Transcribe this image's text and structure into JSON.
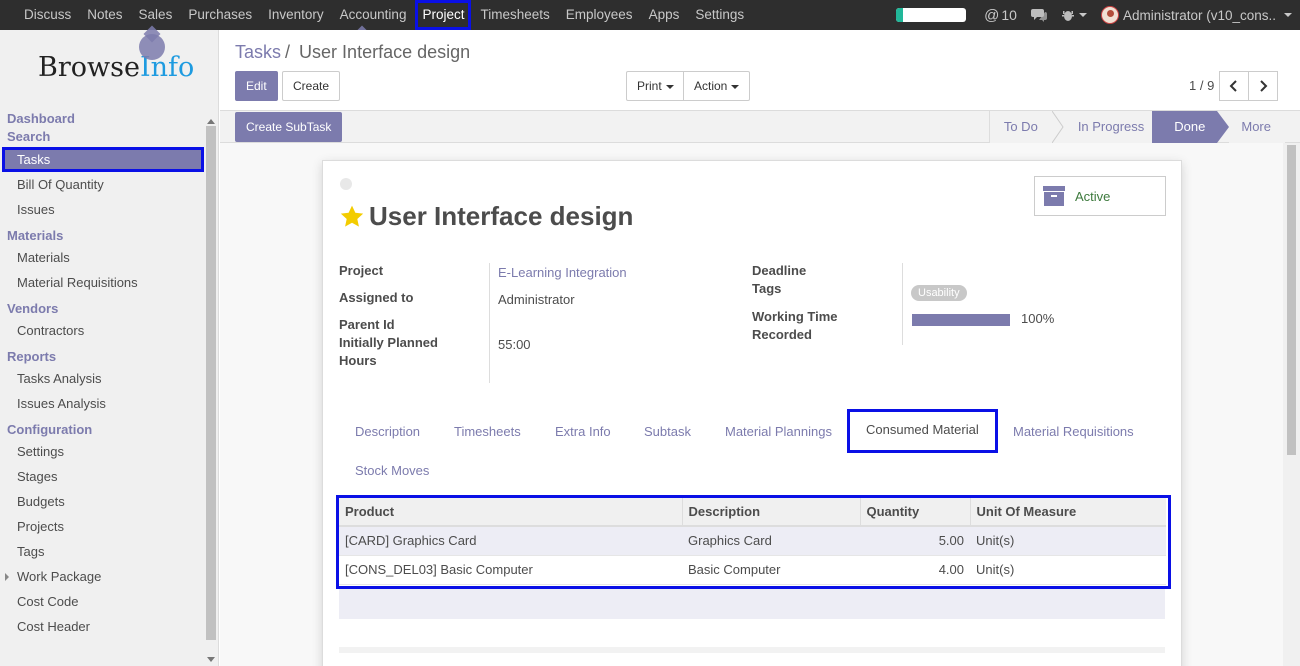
{
  "topbar": {
    "menu": [
      "Discuss",
      "Notes",
      "Sales",
      "Purchases",
      "Inventory",
      "Accounting",
      "Project",
      "Timesheets",
      "Employees",
      "Apps",
      "Settings"
    ],
    "active_menu": "Project",
    "progress_fraction": 0.1,
    "notifications_count": "10",
    "user_label": "Administrator (v10_cons..",
    "icons": [
      "at-icon",
      "chat-icon",
      "bug-icon"
    ]
  },
  "sidebar": {
    "logo_part1": "Browse",
    "logo_part2": "Info",
    "sections": [
      {
        "title": "Dashboard"
      },
      {
        "title": "Search"
      }
    ],
    "dashboard_label": "Dashboard",
    "search_label": "Search",
    "items": {
      "tasks": "Tasks",
      "boq": "Bill Of Quantity",
      "issues": "Issues",
      "materials_sec": "Materials",
      "materials": "Materials",
      "material_req": "Material Requisitions",
      "vendors_sec": "Vendors",
      "contractors": "Contractors",
      "reports_sec": "Reports",
      "tasks_analysis": "Tasks Analysis",
      "issues_analysis": "Issues Analysis",
      "config_sec": "Configuration",
      "settings": "Settings",
      "stages": "Stages",
      "budgets": "Budgets",
      "projects": "Projects",
      "tags": "Tags",
      "work_package": "Work Package",
      "cost_code": "Cost Code",
      "cost_header": "Cost Header"
    }
  },
  "control_panel": {
    "breadcrumb_parent": "Tasks",
    "breadcrumb_sep": "/",
    "breadcrumb_current": "User Interface design",
    "edit_label": "Edit",
    "create_label": "Create",
    "print_label": "Print",
    "action_label": "Action",
    "pager": "1 / 9"
  },
  "statusbar": {
    "create_subtask_label": "Create SubTask",
    "stages": [
      "To Do",
      "In Progress",
      "Done",
      "More"
    ],
    "current_stage": "Done"
  },
  "form": {
    "title": "User Interface design",
    "active_label": "Active",
    "fields": {
      "project_label": "Project",
      "project_value": "E-Learning Integration",
      "assigned_label": "Assigned to",
      "assigned_value": "Administrator",
      "parent_label": "Parent Id",
      "planned_label_1": "Initially Planned",
      "planned_label_2": "Hours",
      "planned_value": "55:00",
      "deadline_label": "Deadline",
      "tags_label": "Tags",
      "tag_value": "Usability",
      "working_label_1": "Working Time",
      "working_label_2": "Recorded",
      "working_value": "100%",
      "working_fraction": 1.0
    },
    "tabs": [
      "Description",
      "Timesheets",
      "Extra Info",
      "Subtask",
      "Material Plannings",
      "Consumed Material",
      "Material Requisitions",
      "Stock Moves"
    ],
    "active_tab": "Consumed Material",
    "table": {
      "headers": [
        "Product",
        "Description",
        "Quantity",
        "Unit Of Measure"
      ],
      "rows": [
        [
          "[CARD] Graphics Card",
          "Graphics Card",
          "5.00",
          "Unit(s)"
        ],
        [
          "[CONS_DEL03] Basic Computer",
          "Basic Computer",
          "4.00",
          "Unit(s)"
        ]
      ]
    }
  },
  "colors": {
    "accent": "#7c7bad",
    "highlight": "#0a10e6",
    "topbar": "#2e2e2e",
    "progress": "#21b799"
  }
}
